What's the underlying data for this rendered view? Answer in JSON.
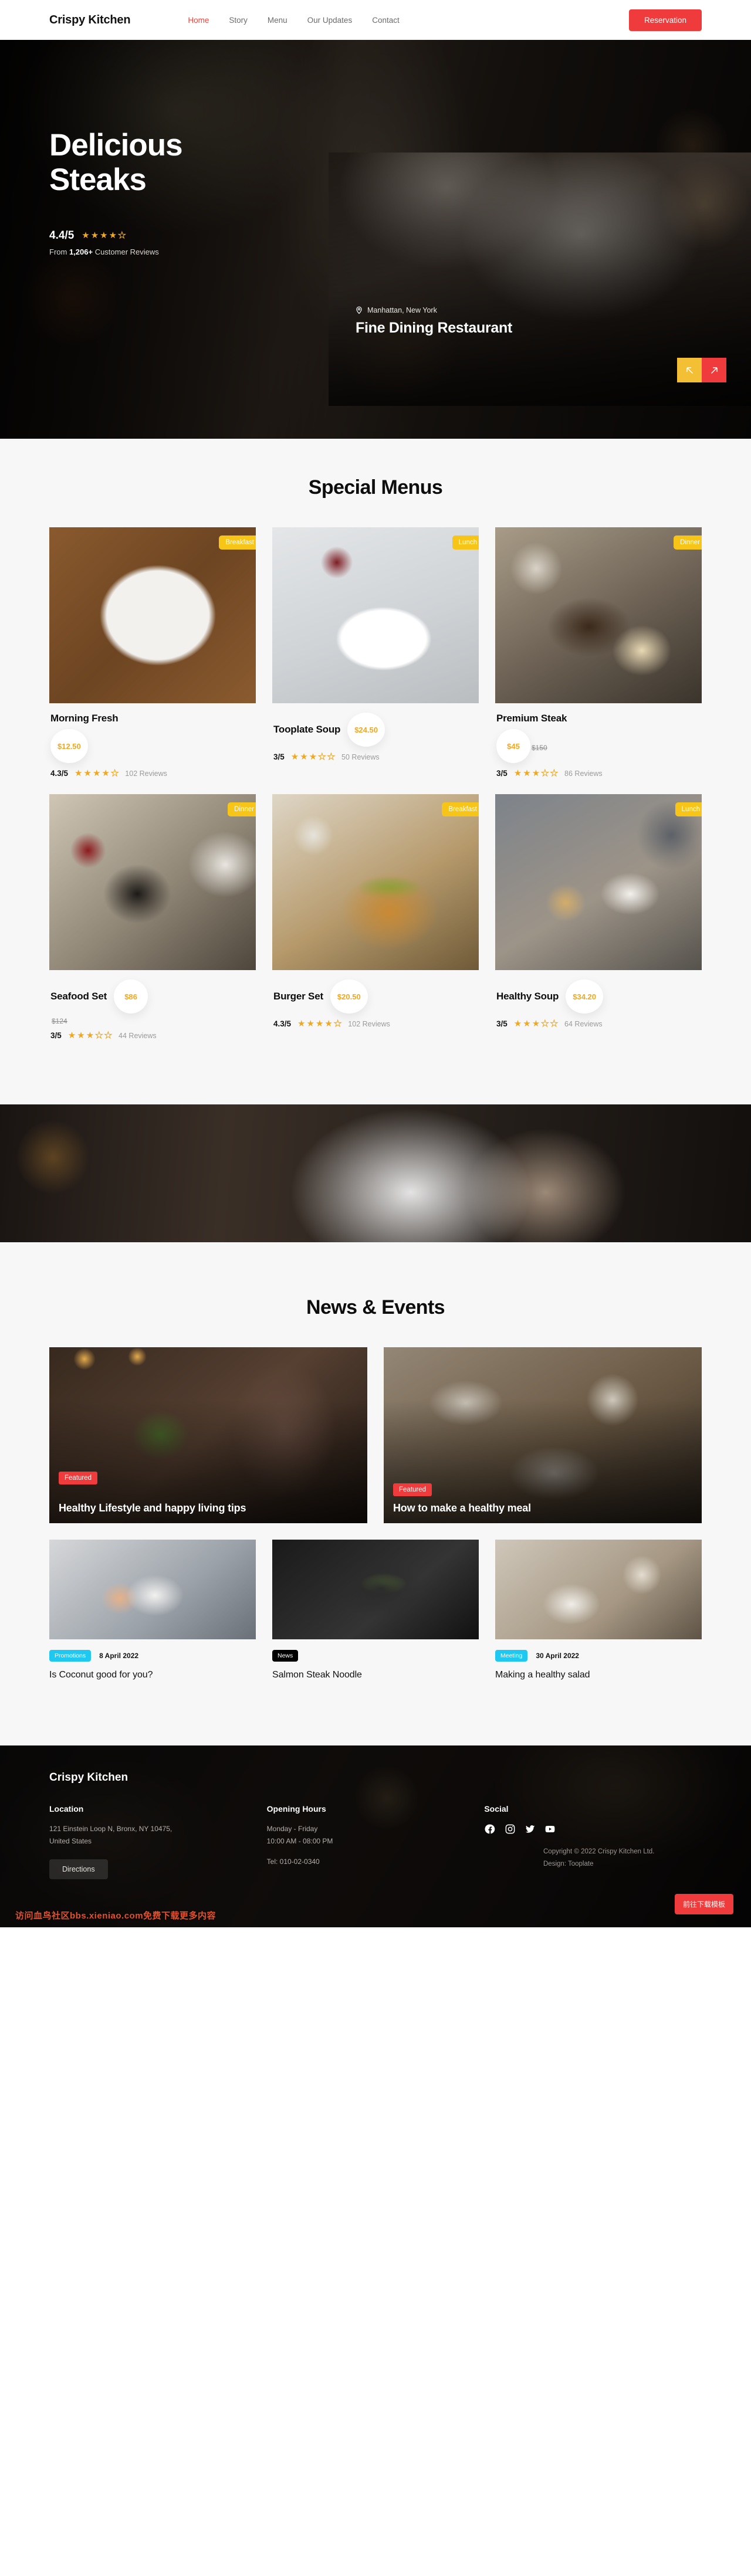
{
  "nav": {
    "brand": "Crispy Kitchen",
    "links": [
      {
        "label": "Home",
        "active": true
      },
      {
        "label": "Story",
        "active": false
      },
      {
        "label": "Menu",
        "active": false
      },
      {
        "label": "Our Updates",
        "active": false
      },
      {
        "label": "Contact",
        "active": false
      }
    ],
    "cta": "Reservation"
  },
  "hero": {
    "title_line1": "Delicious",
    "title_line2": "Steaks",
    "score": "4.4/5",
    "stars_filled": 4,
    "stars_total": 5,
    "reviews_prefix": "From ",
    "reviews_count": "1,206+",
    "reviews_suffix": " Customer Reviews",
    "card": {
      "location": "Manhattan, New York",
      "title": "Fine Dining Restaurant",
      "prev_icon": "arrow-up-left-icon",
      "next_icon": "arrow-up-right-icon",
      "prev_color": "#f3bf35",
      "next_color": "#ef3b3b"
    }
  },
  "menus": {
    "title": "Special Menus",
    "items": [
      {
        "name": "Morning Fresh",
        "category": "Breakfast",
        "price": "$12.50",
        "old_price": "",
        "score": "4.3/5",
        "stars": 4,
        "reviews": "102 Reviews",
        "layout": "stack"
      },
      {
        "name": "Tooplate Soup",
        "category": "Lunch",
        "price": "$24.50",
        "old_price": "",
        "score": "3/5",
        "stars": 3,
        "reviews": "50 Reviews",
        "layout": "inline"
      },
      {
        "name": "Premium Steak",
        "category": "Dinner",
        "price": "$45",
        "old_price": "$150",
        "score": "3/5",
        "stars": 3,
        "reviews": "86 Reviews",
        "layout": "stack"
      },
      {
        "name": "Seafood Set",
        "category": "Dinner",
        "price": "$86",
        "old_price": "$124",
        "score": "3/5",
        "stars": 3,
        "reviews": "44 Reviews",
        "layout": "stack"
      },
      {
        "name": "Burger Set",
        "category": "Breakfast",
        "price": "$20.50",
        "old_price": "",
        "score": "4.3/5",
        "stars": 4,
        "reviews": "102 Reviews",
        "layout": "inline"
      },
      {
        "name": "Healthy Soup",
        "category": "Lunch",
        "price": "$34.20",
        "old_price": "",
        "score": "3/5",
        "stars": 3,
        "reviews": "64 Reviews",
        "layout": "inline"
      }
    ]
  },
  "news": {
    "title": "News & Events",
    "featured": [
      {
        "tag": "Featured",
        "title": "Healthy Lifestyle and happy living tips"
      },
      {
        "tag": "Featured",
        "title": "How to make a healthy meal"
      }
    ],
    "posts": [
      {
        "tag": "Promotions",
        "tag_color": "#1ec8f0",
        "date": "8 April 2022",
        "title": "Is Coconut good for you?"
      },
      {
        "tag": "News",
        "tag_color": "#000000",
        "date": "",
        "title": "Salmon Steak Noodle"
      },
      {
        "tag": "Meeting",
        "tag_color": "#1ec8f0",
        "date": "30 April 2022",
        "title": "Making a healthy salad"
      }
    ]
  },
  "footer": {
    "brand": "Crispy Kitchen",
    "location": {
      "heading": "Location",
      "address": "121 Einstein Loop N, Bronx, NY 10475, United States",
      "button": "Directions"
    },
    "hours": {
      "heading": "Opening Hours",
      "days": "Monday - Friday",
      "time": "10:00 AM - 08:00 PM",
      "tel": "Tel: 010-02-0340"
    },
    "social": {
      "heading": "Social",
      "icons": [
        "facebook-icon",
        "instagram-icon",
        "twitter-icon",
        "youtube-icon"
      ]
    },
    "copyright_line1": "Copyright © 2022 Crispy Kitchen Ltd.",
    "copyright_line2": "Design: Tooplate",
    "download_button": "前往下载模板",
    "watermark": "访问血鸟社区bbs.xieniao.com免费下载更多内容"
  }
}
